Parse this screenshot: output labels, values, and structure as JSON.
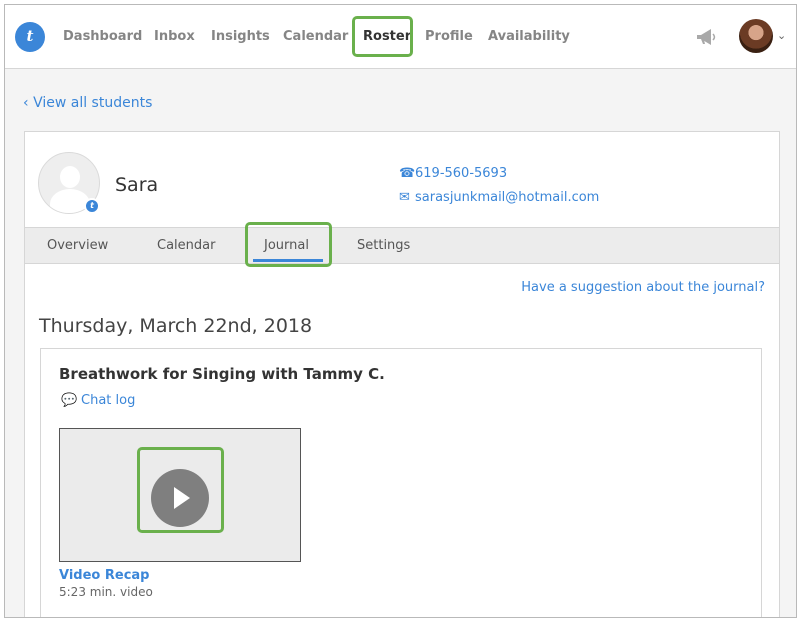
{
  "app": {
    "logo_text": "t"
  },
  "nav": {
    "items": [
      {
        "label": "Dashboard"
      },
      {
        "label": "Inbox"
      },
      {
        "label": "Insights"
      },
      {
        "label": "Calendar"
      },
      {
        "label": "Roster",
        "active": true
      },
      {
        "label": "Profile"
      },
      {
        "label": "Availability"
      }
    ],
    "icons": [
      "announcements-megaphone-icon",
      "user-avatar",
      "chevron-down-icon"
    ]
  },
  "back_link": {
    "label": "View all students",
    "icon": "chevron-left-icon"
  },
  "student": {
    "name": "Sara",
    "phone": "619-560-5693",
    "email": "sarasjunkmail@hotmail.com",
    "photo": "default-profile-silhouette"
  },
  "tabs": [
    {
      "label": "Overview"
    },
    {
      "label": "Calendar"
    },
    {
      "label": "Journal",
      "active": true
    },
    {
      "label": "Settings"
    }
  ],
  "journal": {
    "suggestion_link": "Have a suggestion about the journal?",
    "date": "Thursday, March 22nd, 2018",
    "entry": {
      "title": "Breathwork for Singing with Tammy C.",
      "chat_log_label": "Chat log",
      "video_label": "Video Recap",
      "video_length": "5:23 min. video"
    }
  },
  "colors": {
    "accent": "#3b86d8",
    "highlight": "#6ab04c",
    "tab_bar": "#ececec",
    "page_background": "#f4f4f4"
  }
}
